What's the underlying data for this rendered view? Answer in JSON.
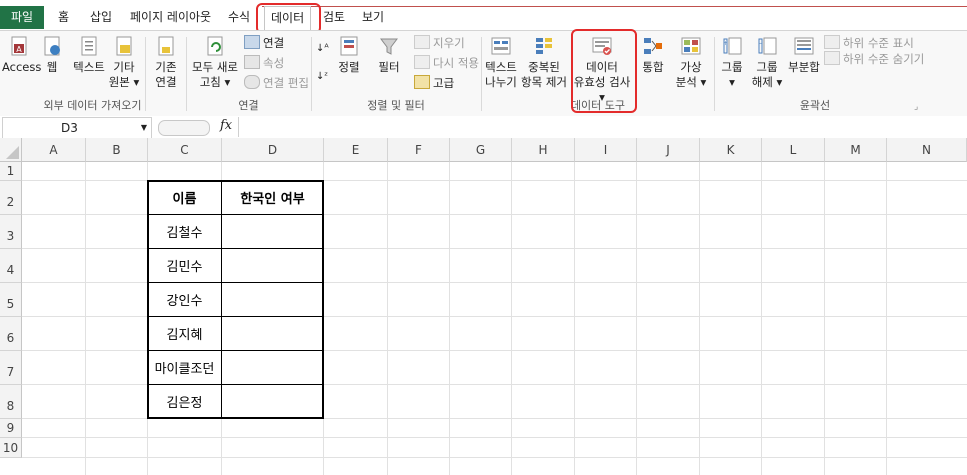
{
  "menu": {
    "file": "파일",
    "tabs": [
      "홈",
      "삽입",
      "페이지 레이아웃",
      "수식",
      "데이터",
      "검토",
      "보기"
    ],
    "active": "데이터"
  },
  "ribbon": {
    "groups": {
      "external_data": "외부 데이터 가져오기",
      "connections": "연결",
      "sort_filter": "정렬 및 필터",
      "data_tools": "데이터 도구",
      "outline": "윤곽선"
    },
    "buttons": {
      "access": "Access",
      "web": "웹",
      "text": "텍스트",
      "other_sources_1": "기타",
      "other_sources_2": "원본 ▾",
      "existing_1": "기존",
      "existing_2": "연결",
      "refresh_1": "모두 새로",
      "refresh_2": "고침 ▾",
      "connections": "연결",
      "properties": "속성",
      "edit_links": "연결 편집",
      "sort": "정렬",
      "filter": "필터",
      "clear": "지우기",
      "reapply": "다시 적용",
      "advanced": "고급",
      "text_to_columns_1": "텍스트",
      "text_to_columns_2": "나누기",
      "remove_duplicates_1": "중복된",
      "remove_duplicates_2": "항목 제거",
      "data_validation_1": "데이터",
      "data_validation_2": "유효성 검사 ▾",
      "consolidate": "통합",
      "what_if_1": "가상",
      "what_if_2": "분석 ▾",
      "group_1": "그룹",
      "group_2": "▾",
      "ungroup_1": "그룹",
      "ungroup_2": "해제 ▾",
      "subtotal": "부분합",
      "show_detail": "하위 수준 표시",
      "hide_detail": "하위 수준 숨기기"
    }
  },
  "formula_bar": {
    "name_box": "D3",
    "fx": "fx",
    "value": ""
  },
  "grid": {
    "columns": [
      "A",
      "B",
      "C",
      "D",
      "E",
      "F",
      "G",
      "H",
      "I",
      "J",
      "K",
      "L",
      "M",
      "N"
    ],
    "rows": [
      "1",
      "2",
      "3",
      "4",
      "5",
      "6",
      "7",
      "8",
      "9",
      "10"
    ]
  },
  "table": {
    "headers": [
      "이름",
      "한국인 여부"
    ],
    "names": [
      "김철수",
      "김민수",
      "강인수",
      "김지혜",
      "마이클조던",
      "김은정"
    ]
  },
  "colors": {
    "file_tab": "#217346",
    "highlight": "#e32b2b"
  }
}
